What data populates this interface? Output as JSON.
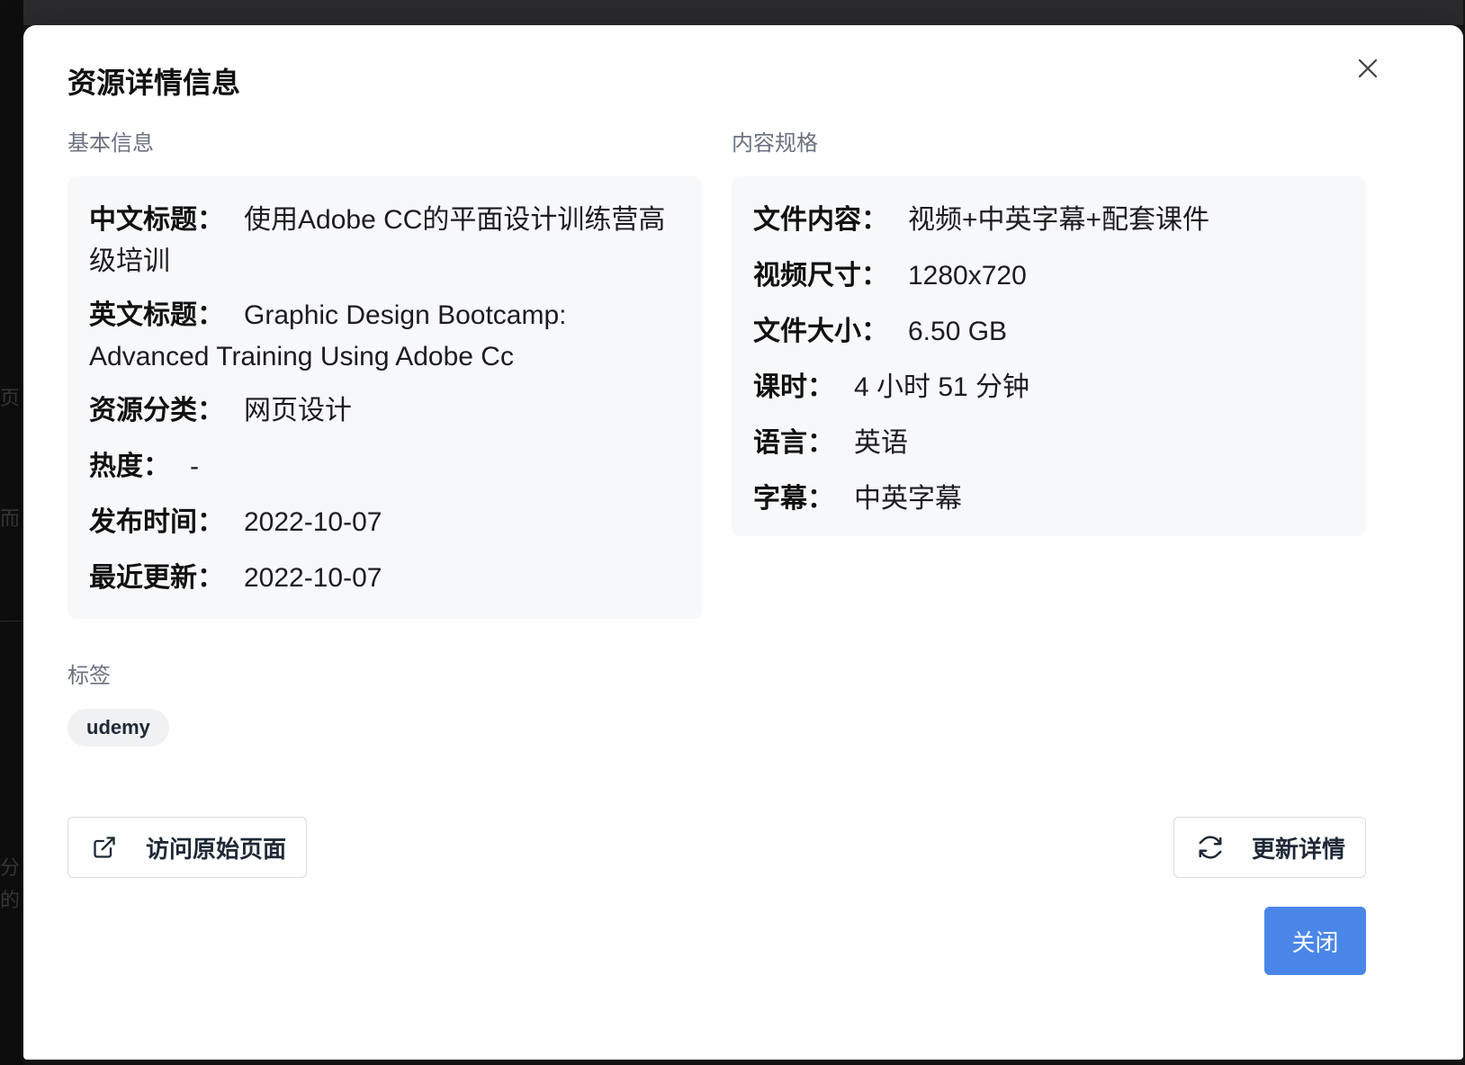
{
  "backdrop": {
    "ghost_chars": [
      "页",
      "而",
      "分",
      "的"
    ]
  },
  "modal": {
    "title": "资源详情信息",
    "close_icon": "close-icon"
  },
  "basic_info": {
    "section_label": "基本信息",
    "rows": [
      {
        "key": "中文标题：",
        "value": "使用Adobe CC的平面设计训练营高级培训"
      },
      {
        "key": "英文标题：",
        "value": "Graphic Design Bootcamp: Advanced Training Using Adobe Cc"
      },
      {
        "key": "资源分类：",
        "value": "网页设计"
      },
      {
        "key": "热度：",
        "value": "-"
      },
      {
        "key": "发布时间：",
        "value": "2022-10-07"
      },
      {
        "key": "最近更新：",
        "value": "2022-10-07"
      }
    ]
  },
  "content_spec": {
    "section_label": "内容规格",
    "rows": [
      {
        "key": "文件内容：",
        "value": "视频+中英字幕+配套课件"
      },
      {
        "key": "视频尺寸：",
        "value": "1280x720"
      },
      {
        "key": "文件大小：",
        "value": "6.50 GB"
      },
      {
        "key": "课时：",
        "value": "4 小时 51 分钟"
      },
      {
        "key": "语言：",
        "value": "英语"
      },
      {
        "key": "字幕：",
        "value": "中英字幕"
      }
    ]
  },
  "tags": {
    "section_label": "标签",
    "items": [
      "udemy"
    ]
  },
  "actions": {
    "visit_label": "访问原始页面",
    "visit_icon": "external-link-icon",
    "refresh_label": "更新详情",
    "refresh_icon": "refresh-icon",
    "close_label": "关闭"
  },
  "colors": {
    "primary": "#4a86e8",
    "panel_bg": "#f7f8fa",
    "muted_text": "#6b7280"
  }
}
